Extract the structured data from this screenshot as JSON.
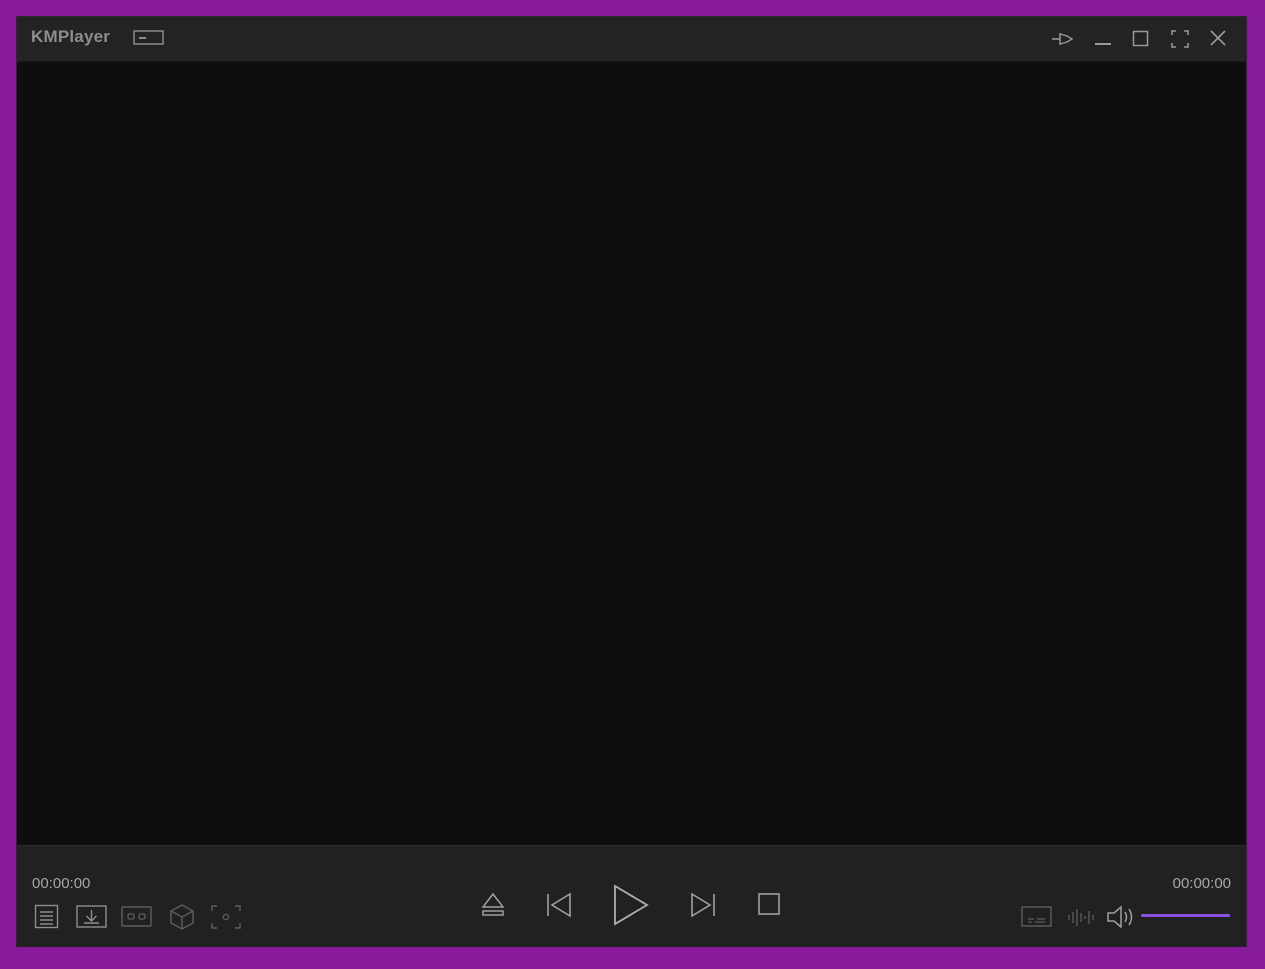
{
  "window": {
    "title": "KMPlayer"
  },
  "titlebar": {
    "buttons": [
      {
        "name": "pin",
        "icon": "pin-icon"
      },
      {
        "name": "minimize",
        "icon": "minimize-icon"
      },
      {
        "name": "maximize",
        "icon": "maximize-icon"
      },
      {
        "name": "fullscreen",
        "icon": "fullscreen-icon"
      },
      {
        "name": "close",
        "icon": "close-icon"
      }
    ],
    "mini_mode_icon": "mini-mode-icon"
  },
  "playback": {
    "current_time": "00:00:00",
    "total_time": "00:00:00",
    "volume_level": 1.0
  },
  "controls": {
    "left_tools": [
      "playlist-icon",
      "download-icon",
      "vr-icon",
      "3d-cube-icon",
      "capture-icon"
    ],
    "center": [
      "eject-icon",
      "previous-icon",
      "play-icon",
      "next-icon",
      "stop-icon"
    ],
    "right_tools": [
      "subtitle-icon",
      "equalizer-icon",
      "volume-icon"
    ]
  },
  "colors": {
    "frame": "#861a9a",
    "titlebar": "#232323",
    "video_bg": "#0e0e0e",
    "controlbar": "#212121",
    "accent": "#8a52e0"
  }
}
